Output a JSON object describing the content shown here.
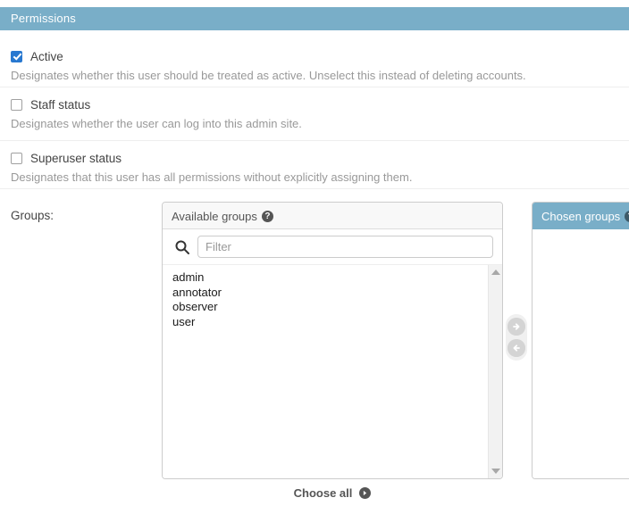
{
  "module": {
    "header": "Permissions"
  },
  "fields": [
    {
      "label": "Active",
      "checked": true,
      "help": "Designates whether this user should be treated as active. Unselect this instead of deleting accounts."
    },
    {
      "label": "Staff status",
      "checked": false,
      "help": "Designates whether the user can log into this admin site."
    },
    {
      "label": "Superuser status",
      "checked": false,
      "help": "Designates that this user has all permissions without explicitly assigning them."
    }
  ],
  "groups": {
    "label": "Groups:",
    "available": {
      "title": "Available groups",
      "help_icon": "question-mark-icon",
      "filter": {
        "icon": "search-icon",
        "value": "",
        "placeholder": "Filter"
      },
      "items": [
        "admin",
        "annotator",
        "observer",
        "user"
      ]
    },
    "chosen": {
      "title": "Chosen groups",
      "help_icon": "question-mark-icon",
      "items": []
    },
    "chooser": {
      "add_icon": "arrow-right-circle-icon",
      "remove_icon": "arrow-left-circle-icon"
    },
    "choose_all": {
      "label": "Choose all",
      "icon": "arrow-right-circle-icon"
    }
  },
  "colors": {
    "accent": "#79aec8",
    "checkbox_checked": "#2878d0",
    "help_text": "#999999",
    "panel_header_bg": "#f8f8f8"
  }
}
